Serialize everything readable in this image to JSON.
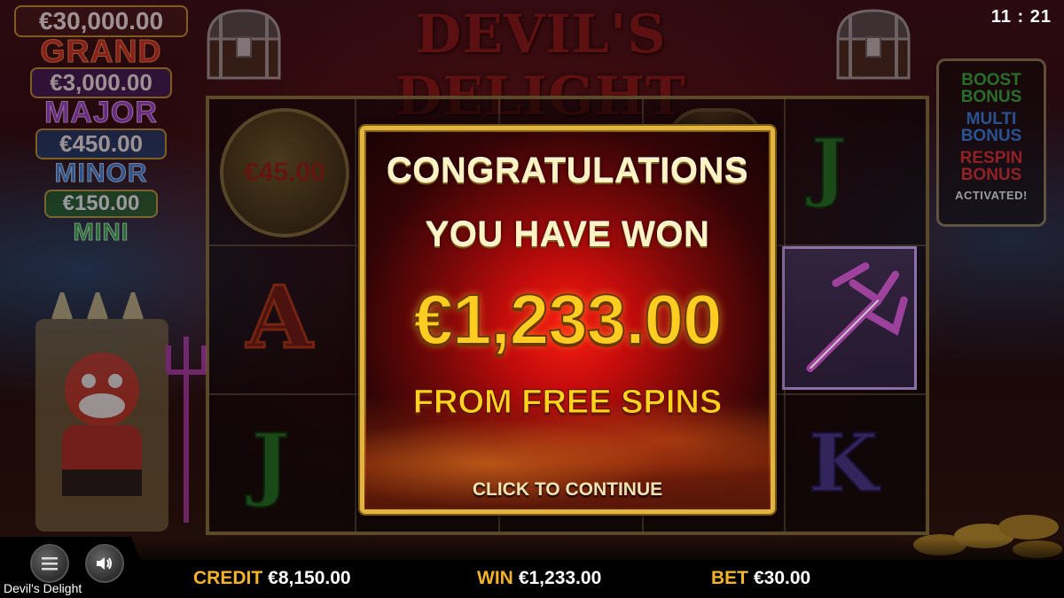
{
  "game": {
    "title": "Devil's Delight",
    "logo_text": "DEVIL'S DELIGHT"
  },
  "clock": "11 : 21",
  "jackpots": [
    {
      "amount": "€30,000.00",
      "label": "GRAND"
    },
    {
      "amount": "€3,000.00",
      "label": "MAJOR"
    },
    {
      "amount": "€450.00",
      "label": "MINOR"
    },
    {
      "amount": "€150.00",
      "label": "MINI"
    }
  ],
  "bonus_panel": {
    "boost": [
      "BOOST",
      "BONUS"
    ],
    "multi": [
      "MULTI",
      "BONUS"
    ],
    "respin": [
      "RESPIN",
      "BONUS"
    ],
    "status": "ACTIVATED!"
  },
  "reels": {
    "coin_value": "€45.00",
    "symbols": [
      "J",
      "A",
      "J",
      "K"
    ]
  },
  "win_dialog": {
    "line1": "CONGRATULATIONS",
    "line2": "YOU HAVE WON",
    "amount": "€1,233.00",
    "source": "FROM FREE SPINS",
    "continue": "CLICK TO CONTINUE"
  },
  "bottom_bar": {
    "credit_label": "CREDIT",
    "credit_value": "€8,150.00",
    "win_label": "WIN",
    "win_value": "€1,233.00",
    "bet_label": "BET",
    "bet_value": "€30.00",
    "app_name": "Devil's Delight"
  },
  "icons": [
    "treasure-chest-icon",
    "menu-icon",
    "speaker-icon",
    "trident-icon",
    "devil-king"
  ],
  "colors": {
    "dialog_border": "#e2b440",
    "stat_label": "#f3b32a",
    "amount_gold": "#ffcc22"
  }
}
